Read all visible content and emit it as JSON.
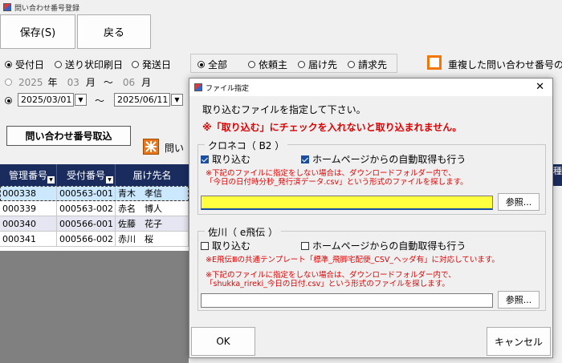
{
  "window": {
    "title": "問い合わせ番号登録"
  },
  "toolbar": {
    "save_label": "保存(S)",
    "back_label": "戻る"
  },
  "date_type": {
    "options": [
      "受付日",
      "送り状印刷日",
      "発送日"
    ],
    "selected": "受付日"
  },
  "month_range": {
    "year": "2025",
    "year_unit": "年",
    "from_month": "03",
    "month_unit": "月",
    "tilde": "～",
    "to_month": "06",
    "to_month_unit": "月"
  },
  "date_range": {
    "from": "2025/03/01",
    "tilde": "～",
    "to": "2025/06/11"
  },
  "target": {
    "options": [
      "全部",
      "依頼主",
      "届け先",
      "請求先"
    ],
    "selected": "全部"
  },
  "duplicate_label": "重複した問い合わせ番号の",
  "import_button": "問い合わせ番号取込",
  "partial_label": "問い",
  "grid": {
    "columns": [
      "管理番号",
      "受付番号",
      "届け先名"
    ],
    "rows": [
      [
        "000338",
        "000563-001",
        "青木　孝信"
      ],
      [
        "000339",
        "000563-002",
        "赤名　博人"
      ],
      [
        "000340",
        "000566-001",
        "佐藤　花子"
      ],
      [
        "000341",
        "000566-002",
        "赤川　桜"
      ]
    ],
    "partial_right_header": "種"
  },
  "dialog": {
    "title": "ファイル指定",
    "instruction": "取り込むファイルを指定して下さい。",
    "warning": "※「取り込む」にチェックを入れないと取り込まれません。",
    "kuroneko": {
      "legend": "クロネコ（ B2 ）",
      "import_label": "取り込む",
      "import_checked": true,
      "auto_label": "ホームページからの自動取得も行う",
      "auto_checked": true,
      "note1": "※下記のファイルに指定をしない場合は、ダウンロードフォルダー内で、",
      "note2": "「今日の日付時分秒_発行済データ.csv」という形式のファイルを探します。",
      "path_value": "",
      "browse_label": "参照..."
    },
    "sagawa": {
      "legend": "佐川（ e飛伝 ）",
      "import_label": "取り込む",
      "import_checked": false,
      "auto_label": "ホームページからの自動取得も行う",
      "auto_checked": false,
      "note0": "※E飛伝Ⅲの共通テンプレート「標準_飛脚宅配便_CSV_ヘッダ有」に対応しています。",
      "note1": "※下記のファイルに指定をしない場合は、ダウンロードフォルダー内で、",
      "note2": "「shukka_rireki_今日の日付.csv」という形式のファイルを探します。",
      "path_value": "",
      "browse_label": "参照..."
    },
    "ok_label": "OK",
    "cancel_label": "キャンセル"
  }
}
